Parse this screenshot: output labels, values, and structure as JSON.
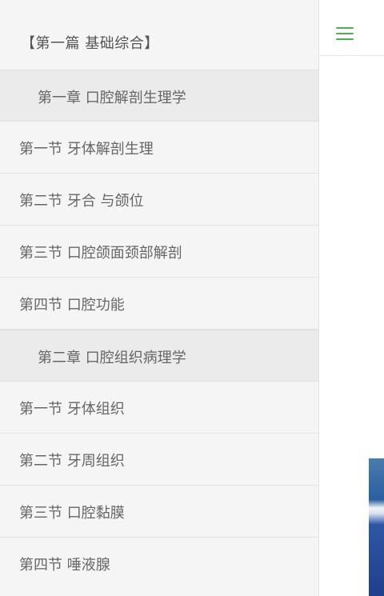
{
  "drawer": {
    "header": "【第一篇 基础综合】",
    "groups": [
      {
        "chapter": "第一章 口腔解剖生理学",
        "sections": [
          "第一节 牙体解剖生理",
          "第二节 牙合 与颌位",
          "第三节 口腔颌面颈部解剖",
          "第四节 口腔功能"
        ]
      },
      {
        "chapter": "第二章 口腔组织病理学",
        "sections": [
          "第一节 牙体组织",
          "第二节 牙周组织",
          "第三节 口腔黏膜",
          "第四节 唾液腺"
        ]
      }
    ]
  },
  "topbar": {
    "menu_icon": "hamburger-menu-icon",
    "accent_color": "#4caf50"
  }
}
